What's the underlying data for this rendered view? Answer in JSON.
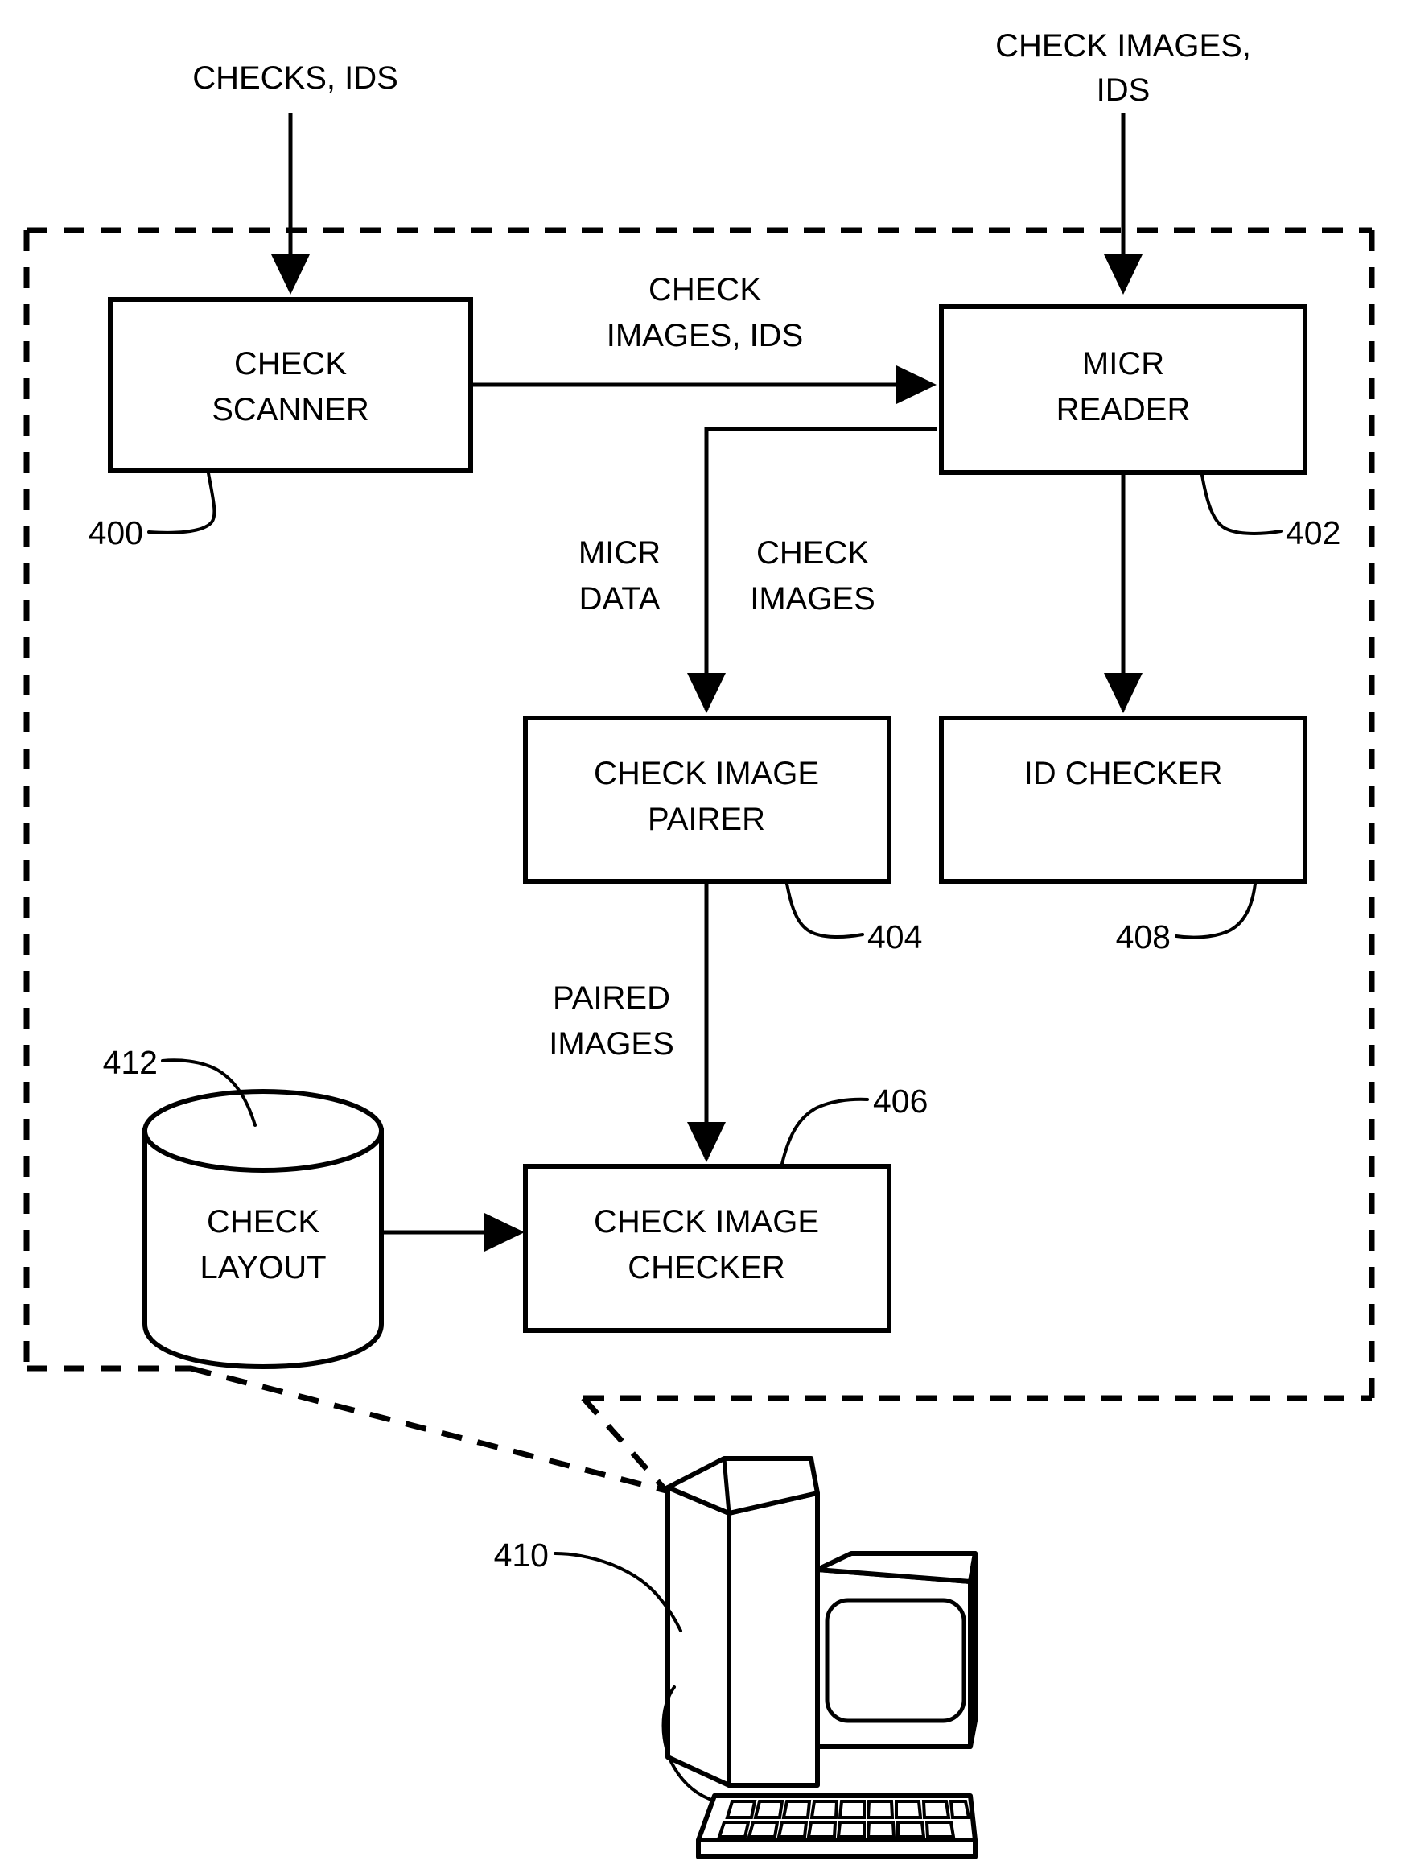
{
  "figure": {
    "type": "patent-block-diagram",
    "title": "Check processing system block diagram"
  },
  "system_boundary": {
    "name": "system-boundary",
    "style": "dashed-rectangle",
    "reference": "410"
  },
  "inputs": [
    {
      "id": "checks-ids",
      "label": "CHECKS, IDS",
      "target": "check-scanner"
    },
    {
      "id": "check-images-ids-top",
      "label": "CHECK IMAGES,\nIDS",
      "line1": "CHECK IMAGES,",
      "line2": "IDS",
      "target": "micr-reader"
    }
  ],
  "blocks": [
    {
      "id": "check-scanner",
      "line1": "CHECK",
      "line2": "SCANNER",
      "reference": "400"
    },
    {
      "id": "micr-reader",
      "line1": "MICR",
      "line2": "READER",
      "reference": "402"
    },
    {
      "id": "check-image-pairer",
      "line1": "CHECK IMAGE",
      "line2": "PAIRER",
      "reference": "404"
    },
    {
      "id": "id-checker",
      "line1": "ID CHECKER",
      "line2": "",
      "reference": "408"
    },
    {
      "id": "check-image-checker",
      "line1": "CHECK IMAGE",
      "line2": "CHECKER",
      "reference": "406"
    }
  ],
  "datastore": {
    "id": "check-layout",
    "line1": "CHECK",
    "line2": "LAYOUT",
    "reference": "412",
    "shape": "cylinder"
  },
  "computer": {
    "id": "computer-workstation",
    "reference": "410",
    "shape": "desktop-computer-with-monitor-and-keyboard"
  },
  "flow_labels": [
    {
      "id": "scanner-to-micr",
      "line1": "CHECK",
      "line2": "IMAGES, IDS"
    },
    {
      "id": "micr-data",
      "line1": "MICR",
      "line2": "DATA"
    },
    {
      "id": "check-images-to-pairer",
      "line1": "CHECK",
      "line2": "IMAGES"
    },
    {
      "id": "paired-images",
      "line1": "PAIRED",
      "line2": "IMAGES"
    }
  ],
  "reference_numerals": {
    "check_scanner": "400",
    "micr_reader": "402",
    "check_image_pairer": "404",
    "check_image_checker": "406",
    "id_checker": "408",
    "computer": "410",
    "check_layout": "412"
  },
  "colors": {
    "line": "#000000",
    "background": "#ffffff",
    "text": "#000000"
  }
}
